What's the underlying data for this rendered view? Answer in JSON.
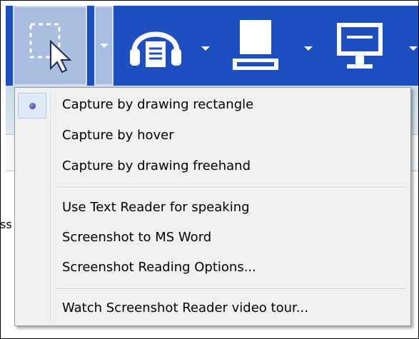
{
  "toolbar": {
    "buttons": [
      {
        "name": "capture-mode",
        "icon": "rectangle-selection-cursor-icon",
        "selected": true
      },
      {
        "name": "audio",
        "icon": "headphones-document-icon"
      },
      {
        "name": "scanner",
        "icon": "scanner-icon"
      },
      {
        "name": "screen",
        "icon": "monitor-icon"
      }
    ],
    "accent": "#1e4fc0"
  },
  "background": {
    "cut_text": "ss"
  },
  "menu": {
    "items": [
      {
        "label": "Capture by drawing rectangle",
        "checked": true
      },
      {
        "label": "Capture by hover"
      },
      {
        "label": "Capture by drawing freehand"
      },
      {
        "label": "Use Text Reader for speaking"
      },
      {
        "label": "Screenshot to MS Word"
      },
      {
        "label": "Screenshot Reading Options..."
      },
      {
        "label": "Watch Screenshot Reader video tour..."
      }
    ]
  }
}
